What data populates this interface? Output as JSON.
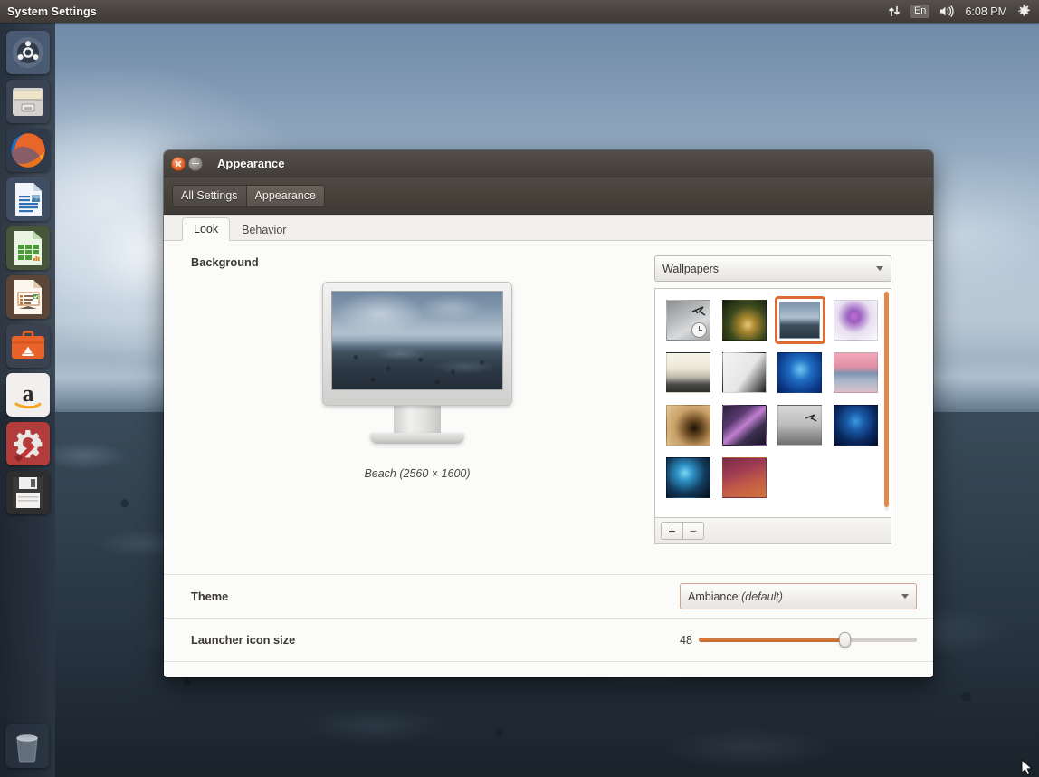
{
  "panel": {
    "title": "System Settings",
    "indicators": {
      "network_icon": "network-updown-icon",
      "keyboard": "En",
      "volume_icon": "volume-icon",
      "clock": "6:08 PM",
      "session_icon": "gear-icon"
    }
  },
  "launcher": {
    "items": [
      {
        "name": "dash-home",
        "icon": "ubuntu-logo-icon"
      },
      {
        "name": "files",
        "icon": "file-manager-icon"
      },
      {
        "name": "firefox",
        "icon": "firefox-icon"
      },
      {
        "name": "libreoffice-writer",
        "icon": "writer-icon"
      },
      {
        "name": "libreoffice-calc",
        "icon": "calc-icon"
      },
      {
        "name": "libreoffice-impress",
        "icon": "impress-icon"
      },
      {
        "name": "ubuntu-software-center",
        "icon": "software-center-icon"
      },
      {
        "name": "amazon",
        "icon": "amazon-icon"
      },
      {
        "name": "system-settings",
        "icon": "system-settings-icon",
        "running": true
      },
      {
        "name": "save-disk",
        "icon": "floppy-disk-icon"
      },
      {
        "name": "trash",
        "icon": "trash-icon"
      }
    ]
  },
  "window": {
    "title": "Appearance",
    "close_label": "×",
    "minimize_label": "−",
    "toolbar": {
      "all_settings": "All Settings",
      "appearance": "Appearance"
    },
    "tabs": [
      {
        "label": "Look",
        "active": true
      },
      {
        "label": "Behavior",
        "active": false
      }
    ],
    "background": {
      "heading": "Background",
      "caption": "Beach (2560 × 1600)",
      "source_label": "Wallpapers",
      "add_label": "+",
      "remove_label": "−",
      "thumbnails": [
        {
          "id": "wp-1",
          "selected": false,
          "badge": "clock-badge"
        },
        {
          "id": "wp-2",
          "selected": false
        },
        {
          "id": "wp-3",
          "selected": true
        },
        {
          "id": "wp-4",
          "selected": false
        },
        {
          "id": "wp-5",
          "selected": false
        },
        {
          "id": "wp-6",
          "selected": false
        },
        {
          "id": "wp-7",
          "selected": false
        },
        {
          "id": "wp-8",
          "selected": false
        },
        {
          "id": "wp-9",
          "selected": false
        },
        {
          "id": "wp-10",
          "selected": false
        },
        {
          "id": "wp-11",
          "selected": false
        },
        {
          "id": "wp-12",
          "selected": false
        },
        {
          "id": "wp-13",
          "selected": false
        },
        {
          "id": "wp-14",
          "selected": false
        }
      ]
    },
    "theme": {
      "label": "Theme",
      "value": "Ambiance",
      "default_suffix": "(default)"
    },
    "launcher_icon_size": {
      "label": "Launcher icon size",
      "value": "48",
      "min": 16,
      "max": 64,
      "percent": 67
    }
  },
  "colors": {
    "accent_orange": "#dd6b33",
    "panel_dark": "#413c38",
    "window_bg": "#fbfbfa",
    "selected_border": "#dd6b33"
  }
}
